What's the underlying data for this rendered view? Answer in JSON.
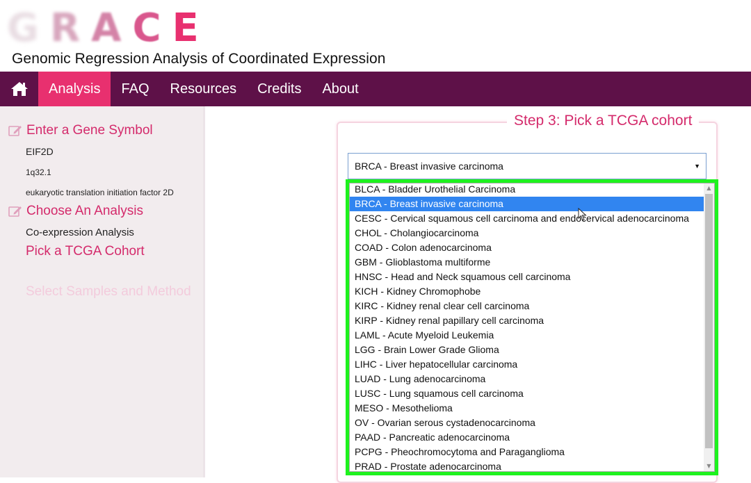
{
  "header": {
    "logo_letters": [
      "G",
      "R",
      "A",
      "C",
      "E"
    ],
    "subtitle": "Genomic Regression Analysis of Coordinated Expression"
  },
  "nav": {
    "home_icon": "home-icon",
    "items": [
      {
        "label": "Analysis",
        "active": true
      },
      {
        "label": "FAQ",
        "active": false
      },
      {
        "label": "Resources",
        "active": false
      },
      {
        "label": "Credits",
        "active": false
      },
      {
        "label": "About",
        "active": false
      }
    ]
  },
  "sidebar": {
    "gene_heading": "Enter a Gene Symbol",
    "gene_symbol": "EIF2D",
    "gene_location": "1q32.1",
    "gene_name": "eukaryotic translation initiation factor 2D",
    "analysis_heading": "Choose An Analysis",
    "analysis_value": "Co-expression Analysis",
    "cohort_step": "Pick a TCGA Cohort",
    "samples_step": "Select Samples and Method",
    "edit_icon": "pencil-edit-icon"
  },
  "panel": {
    "legend": "Step 3: Pick a TCGA cohort",
    "select_value": "BRCA - Breast invasive carcinoma",
    "options": [
      "BLCA - Bladder Urothelial Carcinoma",
      "BRCA - Breast invasive carcinoma",
      "CESC - Cervical squamous cell carcinoma and endocervical adenocarcinoma",
      "CHOL - Cholangiocarcinoma",
      "COAD - Colon adenocarcinoma",
      "GBM - Glioblastoma multiforme",
      "HNSC - Head and Neck squamous cell carcinoma",
      "KICH - Kidney Chromophobe",
      "KIRC - Kidney renal clear cell carcinoma",
      "KIRP - Kidney renal papillary cell carcinoma",
      "LAML - Acute Myeloid Leukemia",
      "LGG - Brain Lower Grade Glioma",
      "LIHC - Liver hepatocellular carcinoma",
      "LUAD - Lung adenocarcinoma",
      "LUSC - Lung squamous cell carcinoma",
      "MESO - Mesothelioma",
      "OV - Ovarian serous cystadenocarcinoma",
      "PAAD - Pancreatic adenocarcinoma",
      "PCPG - Pheochromocytoma and Paraganglioma",
      "PRAD - Prostate adenocarcinoma"
    ],
    "selected_index": 1
  },
  "colors": {
    "nav_bg": "#5e1148",
    "accent": "#e8306f",
    "heading_pink": "#d42a6b",
    "selected_option": "#3185f0",
    "highlight_box": "#1ef21e"
  }
}
